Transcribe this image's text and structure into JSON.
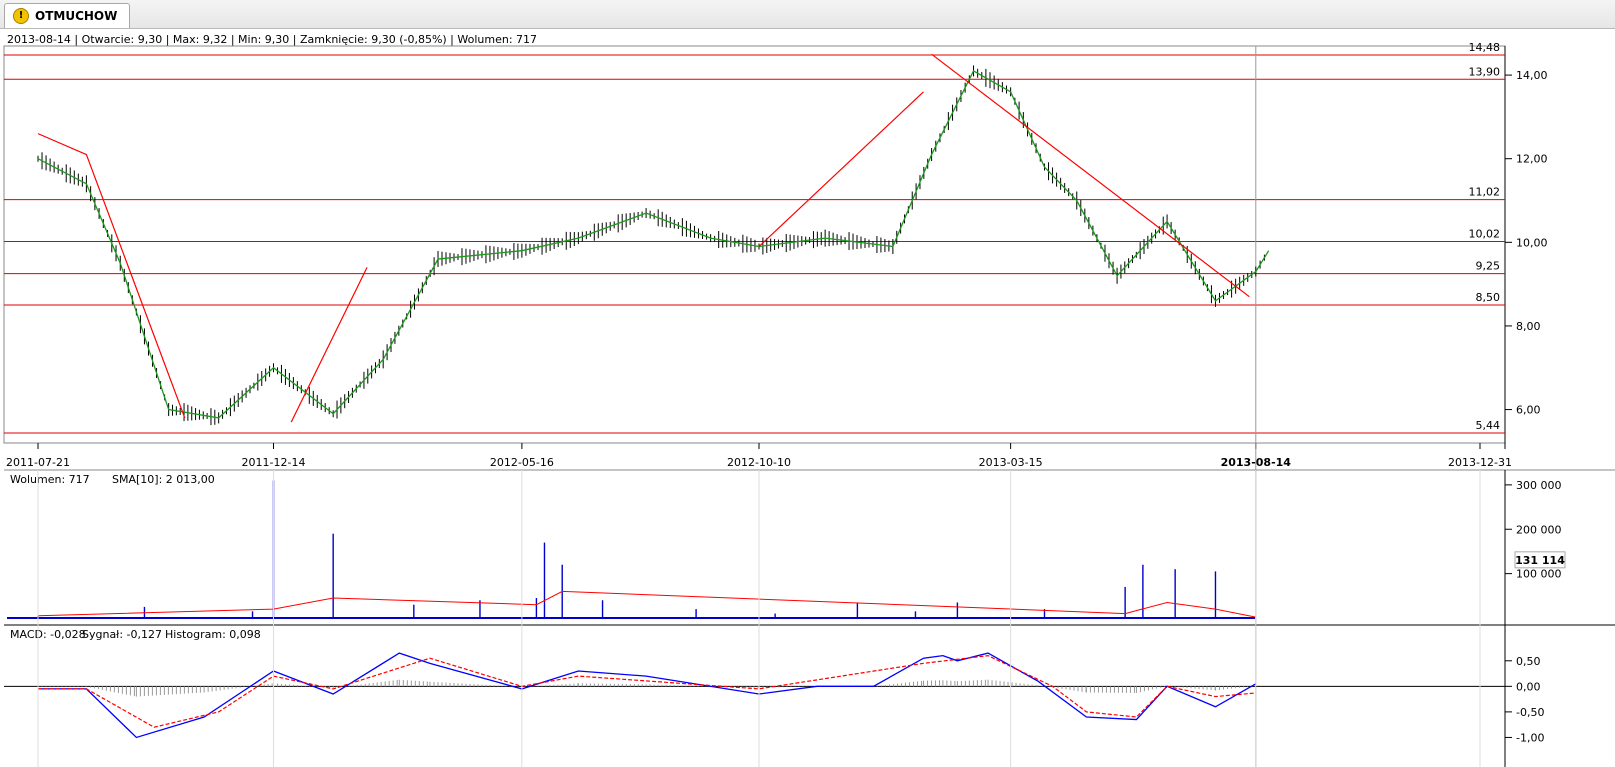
{
  "tab": {
    "label": "OTMUCHOW",
    "icon": "warning-icon"
  },
  "header": {
    "date": "2013-08-14",
    "open": "Otwarcie: 9,30",
    "max": "Max: 9,32",
    "min": "Min: 9,30",
    "close": "Zamknięcie: 9,30 (-0,85%)",
    "volume": "Wolumen: 717"
  },
  "colors": {
    "candle": "#000000",
    "sma": "#1a9a1a",
    "trend": "#ff0000",
    "level": "#e00000",
    "volume": "#0000cc",
    "volume_sma": "#ff0000",
    "macd": "#0000ff",
    "signal": "#ff0000",
    "histogram": "#999999",
    "cursor": "#999999"
  },
  "chart_data": [
    {
      "type": "line",
      "title": "OTMUCHOW",
      "x_ticks": [
        "2011-07-21",
        "2011-12-14",
        "2012-05-16",
        "2012-10-10",
        "2013-03-15",
        "2013-08-14",
        "2013-12-31"
      ],
      "y_ticks": [
        "14,00",
        "12,00",
        "10,00",
        "8,00",
        "6,00"
      ],
      "ylim": [
        5.2,
        14.6
      ],
      "log_scale": false,
      "horizontal_levels": [
        "14,48",
        "13,90",
        "11,02",
        "10,02",
        "9,25",
        "8,50",
        "5,44"
      ],
      "cursor_label": "2013-08-14",
      "series": [
        {
          "name": "close",
          "x": [
            "2011-07-21",
            "2011-08-20",
            "2011-09-10",
            "2011-10-10",
            "2011-11-10",
            "2011-12-14",
            "2012-01-20",
            "2012-02-20",
            "2012-03-25",
            "2012-05-16",
            "2012-06-20",
            "2012-08-01",
            "2012-09-10",
            "2012-10-10",
            "2012-11-20",
            "2013-01-01",
            "2013-01-25",
            "2013-02-20",
            "2013-03-15",
            "2013-04-05",
            "2013-04-25",
            "2013-05-20",
            "2013-06-20",
            "2013-07-20",
            "2013-08-14",
            "2013-08-22"
          ],
          "values": [
            12.0,
            11.4,
            9.5,
            6.0,
            5.8,
            7.0,
            5.9,
            7.2,
            9.6,
            9.8,
            10.1,
            10.7,
            10.1,
            9.9,
            10.1,
            9.9,
            12.1,
            14.1,
            13.6,
            11.8,
            11.0,
            9.2,
            10.5,
            8.6,
            9.3,
            9.8
          ]
        }
      ]
    },
    {
      "type": "bar",
      "title": "",
      "legend": [
        "Wolumen: 717",
        "SMA[10]: 2 013,00"
      ],
      "y_ticks": [
        "300 000",
        "200 000",
        "100 000"
      ],
      "ylim": [
        0,
        320000
      ],
      "cursor_value": "131 114",
      "series": [
        {
          "name": "Wolumen",
          "x": [
            "2011-07-21",
            "2011-09-25",
            "2011-12-01",
            "2011-12-14",
            "2012-01-20",
            "2012-03-10",
            "2012-04-20",
            "2012-05-25",
            "2012-05-30",
            "2012-06-10",
            "2012-07-05",
            "2012-09-01",
            "2012-10-20",
            "2012-12-10",
            "2013-01-15",
            "2013-02-10",
            "2013-04-05",
            "2013-05-25",
            "2013-06-05",
            "2013-06-25",
            "2013-07-20",
            "2013-08-14"
          ],
          "values": [
            5000,
            25000,
            15000,
            310000,
            190000,
            30000,
            40000,
            45000,
            170000,
            120000,
            40000,
            20000,
            10000,
            35000,
            15000,
            35000,
            20000,
            70000,
            120000,
            110000,
            105000,
            717
          ]
        },
        {
          "name": "SMA[10]",
          "x": [
            "2011-07-21",
            "2011-12-14",
            "2012-01-20",
            "2012-05-25",
            "2012-06-10",
            "2013-05-25",
            "2013-06-20",
            "2013-07-20",
            "2013-08-14"
          ],
          "values": [
            5000,
            20000,
            45000,
            30000,
            60000,
            10000,
            35000,
            20000,
            2013
          ]
        }
      ]
    },
    {
      "type": "line",
      "title": "",
      "legend": [
        "MACD: -0,028",
        "Sygnał: -0,127",
        "Histogram: 0,098"
      ],
      "y_ticks": [
        "0,50",
        "0,00",
        "-0,50",
        "-1,00"
      ],
      "ylim": [
        -1.05,
        0.75
      ],
      "series": [
        {
          "name": "MACD",
          "x": [
            "2011-07-21",
            "2011-08-20",
            "2011-09-20",
            "2011-11-01",
            "2011-12-14",
            "2012-01-20",
            "2012-03-01",
            "2012-03-20",
            "2012-05-16",
            "2012-06-20",
            "2012-08-01",
            "2012-10-10",
            "2012-11-15",
            "2012-12-20",
            "2013-01-20",
            "2013-02-01",
            "2013-02-10",
            "2013-03-01",
            "2013-04-01",
            "2013-05-01",
            "2013-06-01",
            "2013-06-20",
            "2013-07-20",
            "2013-08-14"
          ],
          "values": [
            -0.05,
            -0.05,
            -1.0,
            -0.6,
            0.3,
            -0.15,
            0.65,
            0.45,
            -0.05,
            0.3,
            0.2,
            -0.15,
            0.0,
            0.0,
            0.55,
            0.6,
            0.5,
            0.65,
            0.1,
            -0.6,
            -0.65,
            0.0,
            -0.4,
            0.05
          ]
        },
        {
          "name": "Sygnał",
          "x": [
            "2011-07-21",
            "2011-08-20",
            "2011-10-01",
            "2011-11-10",
            "2011-12-14",
            "2012-01-20",
            "2012-03-20",
            "2012-05-16",
            "2012-06-20",
            "2012-10-10",
            "2013-01-20",
            "2013-03-01",
            "2013-04-10",
            "2013-05-01",
            "2013-06-01",
            "2013-06-20",
            "2013-07-20",
            "2013-08-14"
          ],
          "values": [
            -0.05,
            -0.05,
            -0.8,
            -0.5,
            0.2,
            -0.05,
            0.55,
            0.0,
            0.2,
            -0.05,
            0.45,
            0.6,
            0.0,
            -0.5,
            -0.6,
            0.0,
            -0.2,
            -0.13
          ]
        }
      ]
    }
  ]
}
